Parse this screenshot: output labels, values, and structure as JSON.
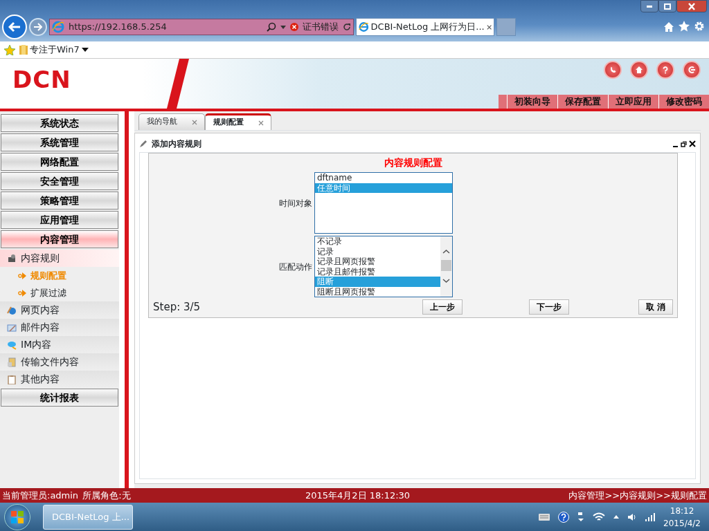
{
  "browser": {
    "address": "https://192.168.5.254",
    "cert_error": "证书错误",
    "tab_title": "DCBI-NetLog 上网行为日...",
    "favorites": [
      {
        "label": "专注于Win7"
      }
    ]
  },
  "header": {
    "logo": "DCN",
    "nav_links": [
      "初装向导",
      "保存配置",
      "立即应用",
      "修改密码"
    ]
  },
  "sidebar": [
    {
      "label": "系统状态",
      "selected": false
    },
    {
      "label": "系统管理",
      "selected": false
    },
    {
      "label": "网络配置",
      "selected": false
    },
    {
      "label": "安全管理",
      "selected": false
    },
    {
      "label": "策略管理",
      "selected": false
    },
    {
      "label": "应用管理",
      "selected": false
    },
    {
      "label": "内容管理",
      "selected": true,
      "children": [
        {
          "label": "内容规则",
          "selected": true,
          "children": [
            {
              "label": "规则配置",
              "selected": true
            },
            {
              "label": "扩展过滤",
              "selected": false
            }
          ]
        },
        {
          "label": "网页内容",
          "selected": false
        },
        {
          "label": "邮件内容",
          "selected": false
        },
        {
          "label": "IM内容",
          "selected": false
        },
        {
          "label": "传输文件内容",
          "selected": false
        },
        {
          "label": "其他内容",
          "selected": false
        }
      ]
    },
    {
      "label": "统计报表",
      "selected": false
    }
  ],
  "tabs": [
    {
      "label": "我的导航",
      "selected": false
    },
    {
      "label": "规则配置",
      "selected": true
    }
  ],
  "panel": {
    "title": "添加内容规则",
    "form": {
      "heading": "内容规则配置",
      "fields": [
        {
          "label": "时间对象",
          "scrollable": false,
          "options": [
            {
              "text": "dftname",
              "selected": false
            },
            {
              "text": "任意时间",
              "selected": true
            }
          ]
        },
        {
          "label": "匹配动作",
          "scrollable": true,
          "options": [
            {
              "text": "不记录",
              "selected": false
            },
            {
              "text": "记录",
              "selected": false
            },
            {
              "text": "记录且网页报警",
              "selected": false
            },
            {
              "text": "记录且邮件报警",
              "selected": false
            },
            {
              "text": "阻断",
              "selected": true
            },
            {
              "text": "阻断且网页报警",
              "selected": false
            }
          ]
        }
      ],
      "step": "Step: 3/5",
      "buttons": [
        "上一步",
        "下一步",
        "取 消"
      ]
    }
  },
  "status_bar": {
    "user": "当前管理员:admin",
    "role": "所属角色:无",
    "datetime": "2015年4月2日  18:12:30",
    "breadcrumb": "内容管理>>内容规则>>规则配置"
  },
  "taskbar": {
    "task": "DCBI-NetLog 上...",
    "time": "18:12",
    "date": "2015/4/2"
  }
}
